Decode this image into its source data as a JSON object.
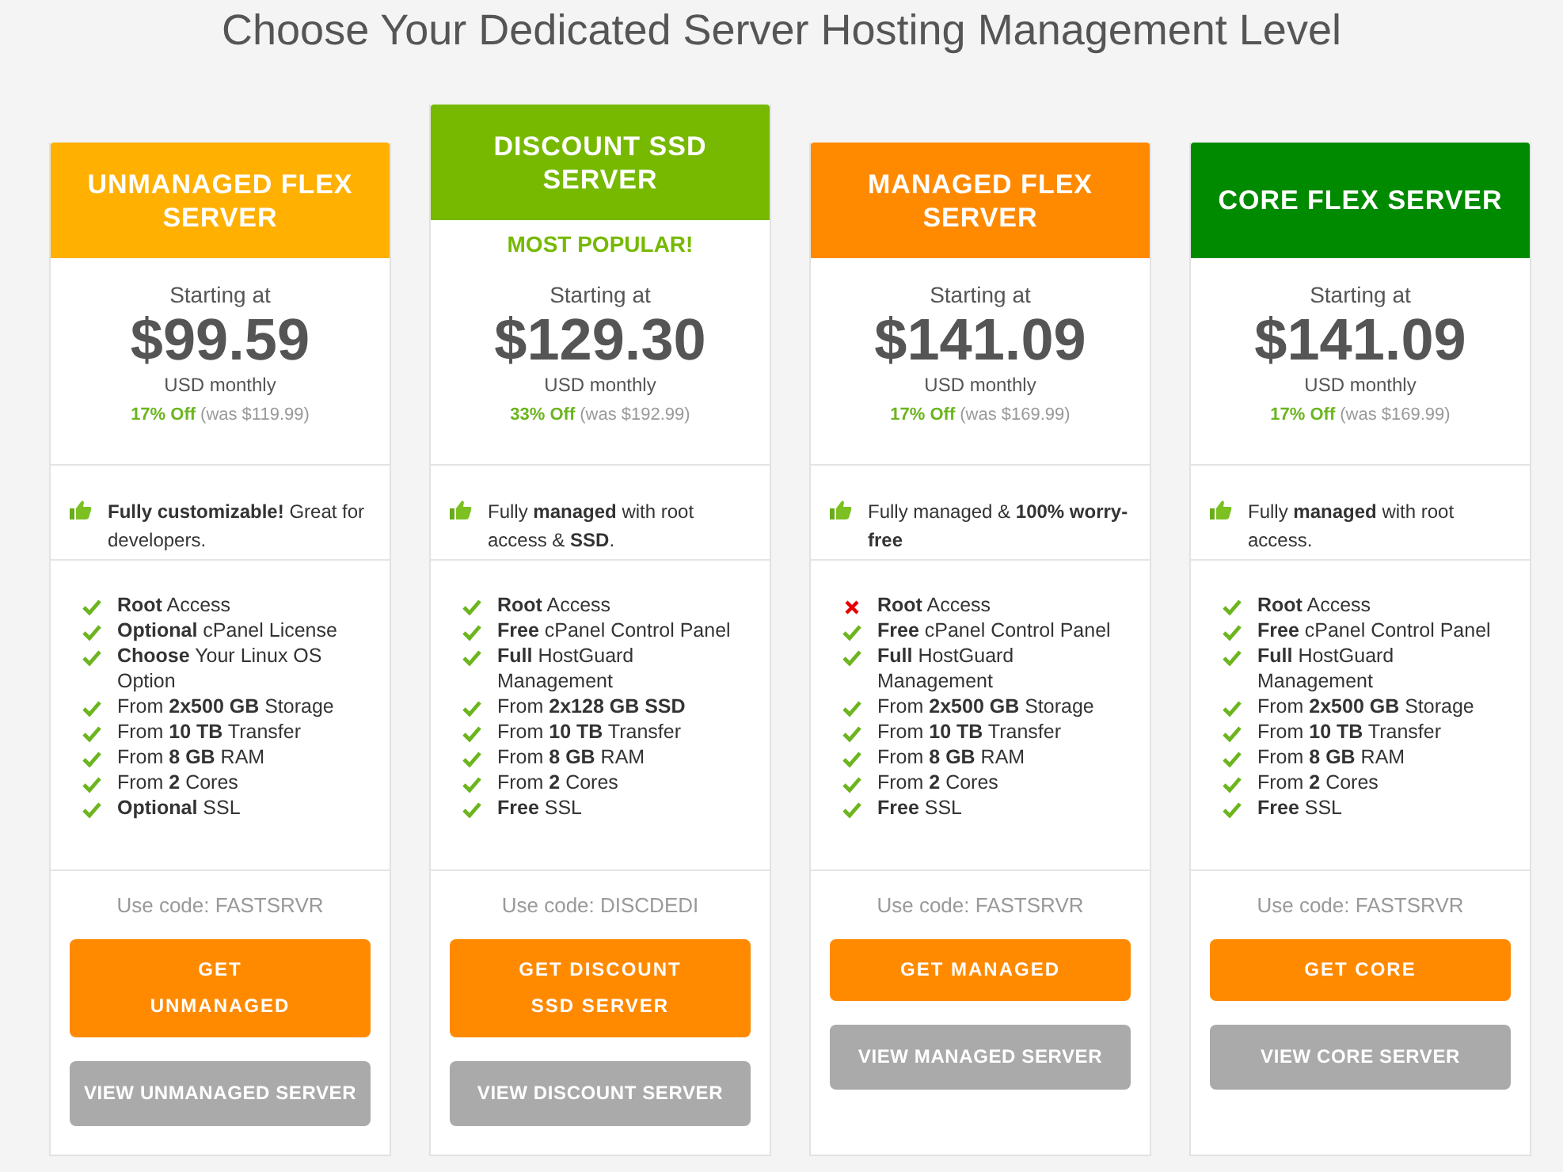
{
  "title": "Choose Your Dedicated Server Hosting Management Level",
  "plans": [
    {
      "name": "UNMANAGED FLEX SERVER",
      "color": "#ffb000",
      "starting": "Starting at",
      "price": "$99.59",
      "period": "USD monthly",
      "discount": "17% Off",
      "was": "(was $119.99)",
      "tagline": "**Fully customizable!** Great for developers.",
      "features": [
        {
          "text": "**Root** Access",
          "included": true
        },
        {
          "text": "**Optional** cPanel License",
          "included": true
        },
        {
          "text": "**Choose** Your Linux OS Option",
          "included": true
        },
        {
          "text": "From **2x500 GB** Storage",
          "included": true
        },
        {
          "text": "From **10 TB** Transfer",
          "included": true
        },
        {
          "text": "From **8 GB** RAM",
          "included": true
        },
        {
          "text": "From **2** Cores",
          "included": true
        },
        {
          "text": "**Optional** SSL",
          "included": true
        }
      ],
      "code": "Use code: FASTSRVR",
      "get_button": "GET UNMANAGED",
      "view_button": "VIEW UNMANAGED SERVER"
    },
    {
      "name": "DISCOUNT SSD SERVER",
      "color": "#76b900",
      "badge": "MOST POPULAR!",
      "starting": "Starting at",
      "price": "$129.30",
      "period": "USD monthly",
      "discount": "33% Off",
      "was": "(was $192.99)",
      "tagline": "Fully **managed** with root access & **SSD**.",
      "features": [
        {
          "text": "**Root** Access",
          "included": true
        },
        {
          "text": "**Free** cPanel Control Panel",
          "included": true
        },
        {
          "text": "**Full** HostGuard Management",
          "included": true
        },
        {
          "text": "From **2x128 GB SSD**",
          "included": true
        },
        {
          "text": "From **10 TB** Transfer",
          "included": true
        },
        {
          "text": "From **8 GB** RAM",
          "included": true
        },
        {
          "text": "From **2** Cores",
          "included": true
        },
        {
          "text": "**Free** SSL",
          "included": true
        }
      ],
      "code": "Use code: DISCDEDI",
      "get_button": "GET DISCOUNT SSD SERVER",
      "view_button": "VIEW DISCOUNT SERVER"
    },
    {
      "name": "MANAGED FLEX SERVER",
      "color": "#ff8a00",
      "starting": "Starting at",
      "price": "$141.09",
      "period": "USD monthly",
      "discount": "17% Off",
      "was": "(was $169.99)",
      "tagline": "Fully managed & **100% worry-free**",
      "features": [
        {
          "text": "**Root** Access",
          "included": false
        },
        {
          "text": "**Free** cPanel Control Panel",
          "included": true
        },
        {
          "text": "**Full** HostGuard Management",
          "included": true
        },
        {
          "text": "From **2x500 GB** Storage",
          "included": true
        },
        {
          "text": "From **10 TB** Transfer",
          "included": true
        },
        {
          "text": "From **8 GB** RAM",
          "included": true
        },
        {
          "text": "From **2** Cores",
          "included": true
        },
        {
          "text": "**Free** SSL",
          "included": true
        }
      ],
      "code": "Use code: FASTSRVR",
      "get_button": "GET MANAGED",
      "view_button": "VIEW MANAGED SERVER"
    },
    {
      "name": "CORE FLEX SERVER",
      "color": "#008a00",
      "starting": "Starting at",
      "price": "$141.09",
      "period": "USD monthly",
      "discount": "17% Off",
      "was": "(was $169.99)",
      "tagline": "Fully **managed** with root access.",
      "features": [
        {
          "text": "**Root** Access",
          "included": true
        },
        {
          "text": "**Free** cPanel Control Panel",
          "included": true
        },
        {
          "text": "**Full** HostGuard Management",
          "included": true
        },
        {
          "text": "From **2x500 GB** Storage",
          "included": true
        },
        {
          "text": "From **10 TB** Transfer",
          "included": true
        },
        {
          "text": "From **8 GB** RAM",
          "included": true
        },
        {
          "text": "From **2** Cores",
          "included": true
        },
        {
          "text": "**Free** SSL",
          "included": true
        }
      ],
      "code": "Use code: FASTSRVR",
      "get_button": "GET CORE",
      "view_button": "VIEW CORE SERVER"
    }
  ]
}
